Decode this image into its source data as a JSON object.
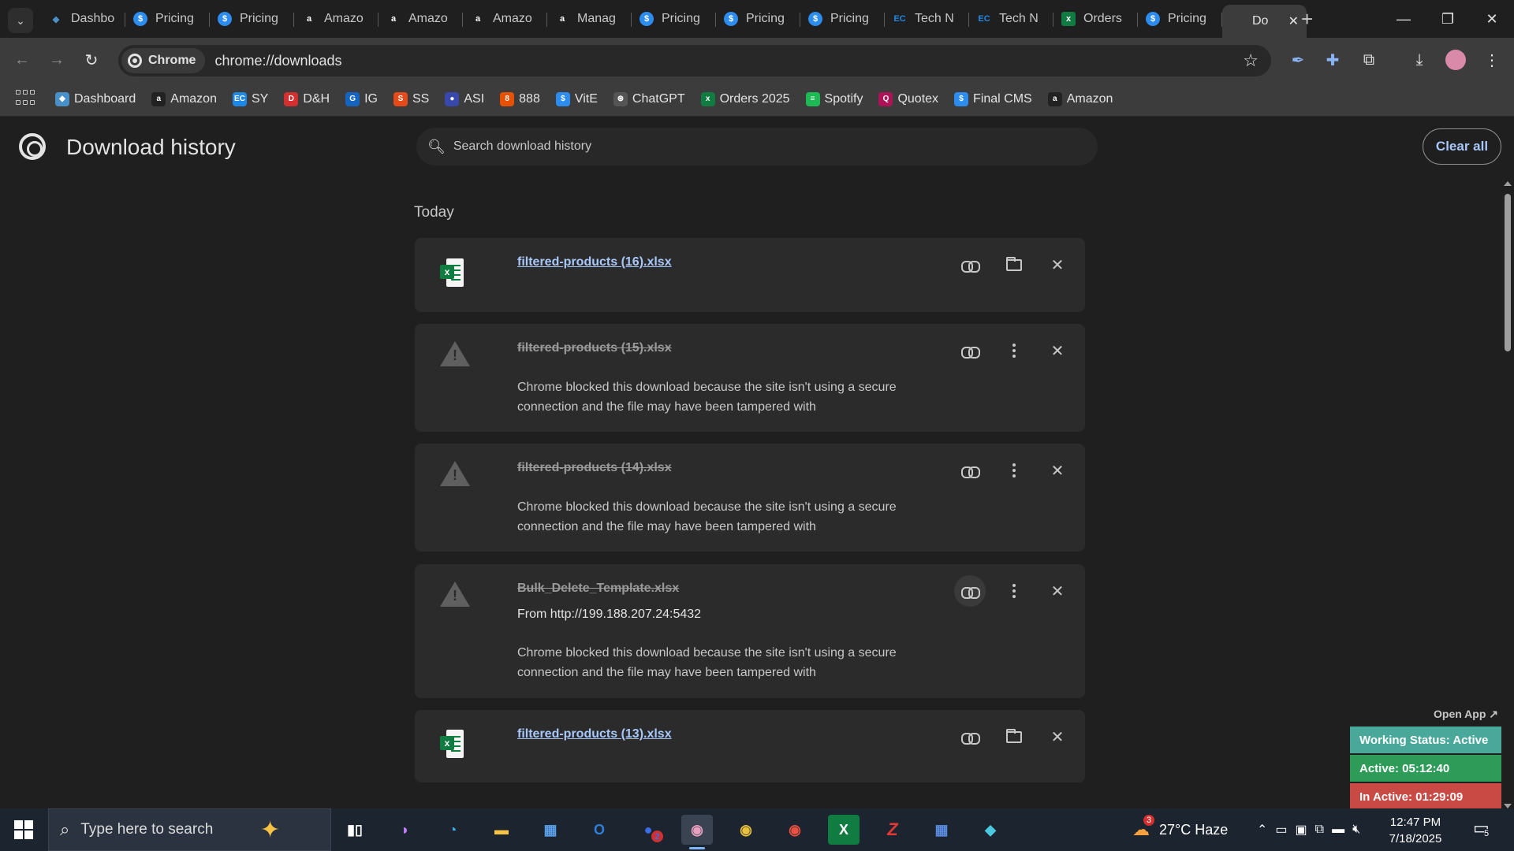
{
  "tabs": [
    {
      "title": "Dashbo",
      "icon": "dashboard-favicon",
      "color": "#4a90c8",
      "glyph": "◆"
    },
    {
      "title": "Pricing",
      "icon": "dollar-favicon",
      "color": "#2d8cf0",
      "glyph": "$"
    },
    {
      "title": "Pricing",
      "icon": "dollar-favicon",
      "color": "#2d8cf0",
      "glyph": "$"
    },
    {
      "title": "Amazo",
      "icon": "amazon-favicon",
      "color": "#ffffff",
      "glyph": "a"
    },
    {
      "title": "Amazo",
      "icon": "amazon-favicon",
      "color": "#ffffff",
      "glyph": "a"
    },
    {
      "title": "Amazo",
      "icon": "amazon-favicon",
      "color": "#ffffff",
      "glyph": "a"
    },
    {
      "title": "Manag",
      "icon": "amazon-favicon",
      "color": "#ffffff",
      "glyph": "a"
    },
    {
      "title": "Pricing",
      "icon": "dollar-favicon",
      "color": "#2d8cf0",
      "glyph": "$"
    },
    {
      "title": "Pricing",
      "icon": "dollar-favicon",
      "color": "#2d8cf0",
      "glyph": "$"
    },
    {
      "title": "Pricing",
      "icon": "dollar-favicon",
      "color": "#2d8cf0",
      "glyph": "$"
    },
    {
      "title": "Tech N",
      "icon": "ec-favicon",
      "color": "#1e88e5",
      "glyph": "EC"
    },
    {
      "title": "Tech N",
      "icon": "ec-favicon",
      "color": "#1e88e5",
      "glyph": "EC"
    },
    {
      "title": "Orders",
      "icon": "sheets-favicon",
      "color": "#107c41",
      "glyph": "x"
    },
    {
      "title": "Pricing",
      "icon": "dollar-favicon",
      "color": "#2d8cf0",
      "glyph": "$"
    },
    {
      "title": "Do",
      "icon": "download-favicon",
      "color": "#3c3c3c",
      "glyph": "⤓",
      "active": true
    }
  ],
  "window_controls": {
    "minimize": "—",
    "maximize": "❐",
    "close": "✕"
  },
  "toolbar": {
    "chip_label": "Chrome",
    "url": "chrome://downloads"
  },
  "bookmarks": [
    {
      "label": "Dashboard",
      "icon": "dashboard-favicon",
      "color": "#4a90c8",
      "glyph": "◆"
    },
    {
      "label": "Amazon",
      "icon": "amazon-favicon",
      "color": "#222222",
      "glyph": "a"
    },
    {
      "label": "SY",
      "icon": "ec-favicon",
      "color": "#1e88e5",
      "glyph": "EC"
    },
    {
      "label": "D&H",
      "icon": "dh-favicon",
      "color": "#d32f2f",
      "glyph": "D"
    },
    {
      "label": "IG",
      "icon": "ig-favicon",
      "color": "#1565c0",
      "glyph": "G"
    },
    {
      "label": "SS",
      "icon": "ss-favicon",
      "color": "#e64a19",
      "glyph": "S"
    },
    {
      "label": "ASI",
      "icon": "asi-favicon",
      "color": "#3949ab",
      "glyph": "●"
    },
    {
      "label": "888",
      "icon": "888-favicon",
      "color": "#e65100",
      "glyph": "8"
    },
    {
      "label": "VitE",
      "icon": "dollar-favicon",
      "color": "#2d8cf0",
      "glyph": "$"
    },
    {
      "label": "ChatGPT",
      "icon": "chatgpt-favicon",
      "color": "#555555",
      "glyph": "⊛"
    },
    {
      "label": "Orders 2025",
      "icon": "sheets-favicon",
      "color": "#107c41",
      "glyph": "x"
    },
    {
      "label": "Spotify",
      "icon": "spotify-favicon",
      "color": "#1db954",
      "glyph": "≡"
    },
    {
      "label": "Quotex",
      "icon": "quotex-favicon",
      "color": "#ad1457",
      "glyph": "Q"
    },
    {
      "label": "Final CMS",
      "icon": "dollar-favicon",
      "color": "#2d8cf0",
      "glyph": "$"
    },
    {
      "label": "Amazon",
      "icon": "amazon-favicon",
      "color": "#222222",
      "glyph": "a"
    }
  ],
  "page": {
    "title": "Download history",
    "search_placeholder": "Search download history",
    "clear_all": "Clear all",
    "section_date": "Today"
  },
  "downloads": [
    {
      "filename": "filtered-products (16).xlsx",
      "status": "complete"
    },
    {
      "filename": "filtered-products (15).xlsx",
      "status": "blocked",
      "message": "Chrome blocked this download because the site isn't using a secure connection and the file may have been tampered with"
    },
    {
      "filename": "filtered-products (14).xlsx",
      "status": "blocked",
      "message": "Chrome blocked this download because the site isn't using a secure connection and the file may have been tampered with"
    },
    {
      "filename": "Bulk_Delete_Template.xlsx",
      "status": "blocked",
      "from": "From http://199.188.207.24:5432",
      "message": "Chrome blocked this download because the site isn't using a secure connection and the file may have been tampered with"
    },
    {
      "filename": "filtered-products (13).xlsx",
      "status": "complete"
    }
  ],
  "widget": {
    "open_app": "Open App ↗",
    "working_status": "Working Status: Active",
    "active": "Active: 05:12:40",
    "inactive": "In Active: 01:29:09",
    "colors": {
      "working": "#4aa89a",
      "active": "#2e9c58",
      "inactive": "#c94a44"
    }
  },
  "taskbar": {
    "search_placeholder": "Type here to search",
    "weather": "27°C  Haze",
    "weather_badge": "3",
    "time": "12:47 PM",
    "date": "7/18/2025",
    "notification_count": "5",
    "outlook_badge": "2"
  }
}
